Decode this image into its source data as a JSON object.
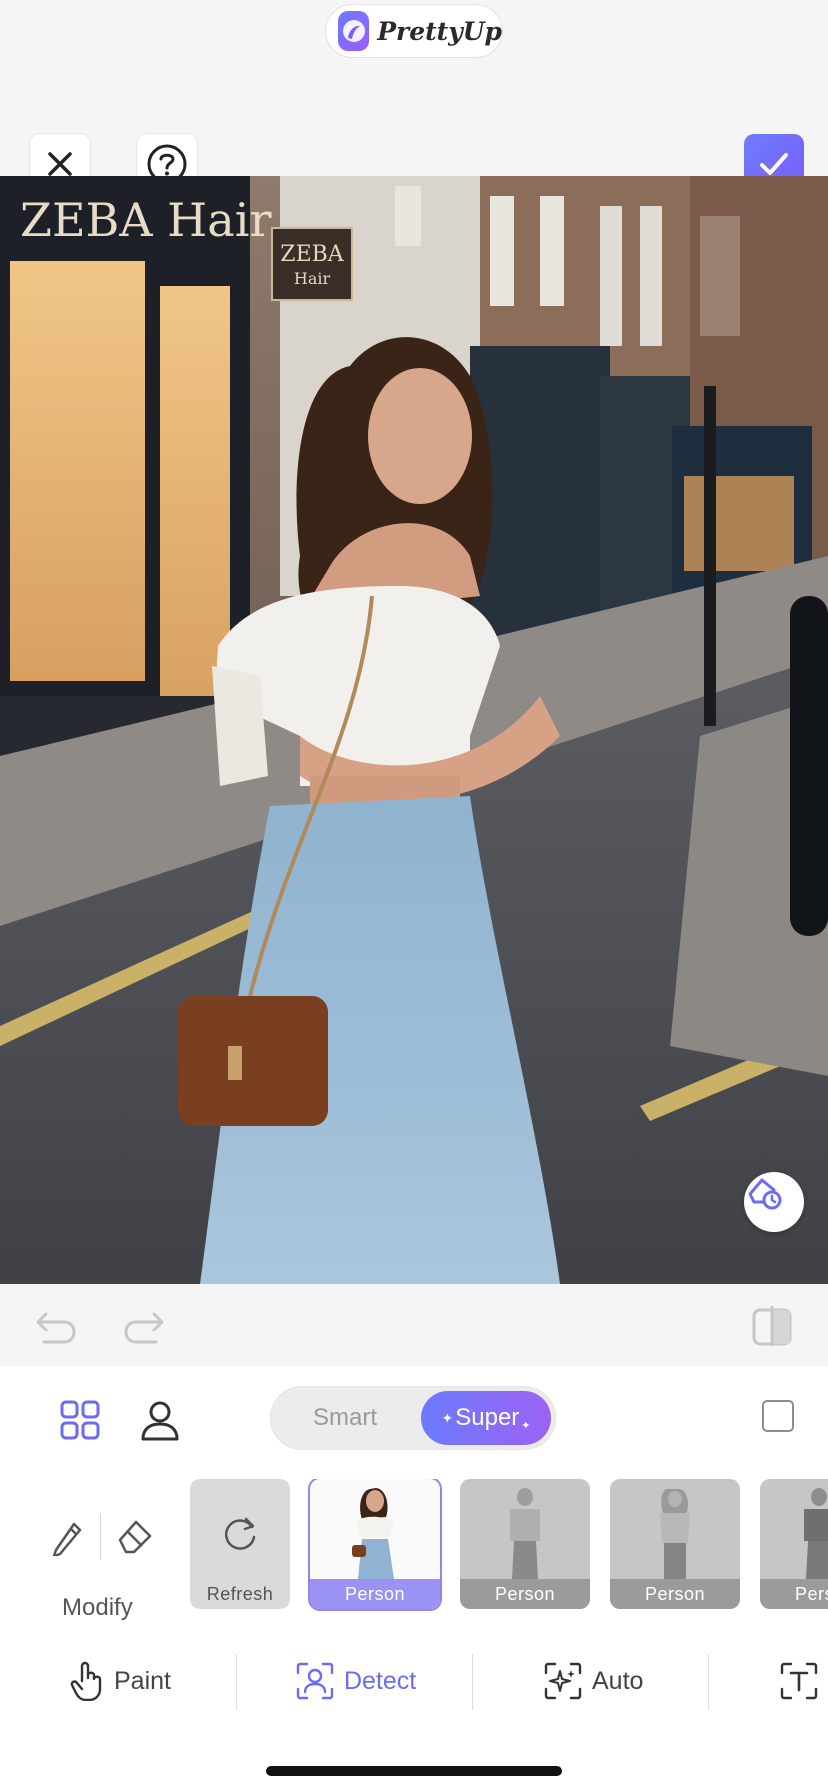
{
  "app": {
    "name": "PrettyUp"
  },
  "header": {
    "close_icon": "close-icon",
    "help_icon": "question-mark-icon",
    "confirm_icon": "checkmark-icon",
    "accent": "#6d7dff"
  },
  "photo": {
    "storefront_sign": "ZEBA Hair",
    "hanging_sign_line1": "ZEBA",
    "hanging_sign_line2": "Hair",
    "restore_icon": "eraser-clock-icon"
  },
  "history": {
    "undo_icon": "undo-icon",
    "redo_icon": "redo-icon",
    "compare_icon": "compare-icon"
  },
  "panel": {
    "grid_icon": "grid-icon",
    "person_icon": "person-icon",
    "segment": {
      "smart": "Smart",
      "super": "Super",
      "selected": "Super"
    },
    "modify_label": "Modify",
    "thumbnails": [
      {
        "label": "Refresh",
        "kind": "refresh"
      },
      {
        "label": "Person",
        "kind": "selected"
      },
      {
        "label": "Person",
        "kind": "dim"
      },
      {
        "label": "Person",
        "kind": "dim"
      },
      {
        "label": "Person",
        "kind": "dim"
      }
    ],
    "tabs": [
      {
        "label": "Paint",
        "icon": "hand-pointer-icon",
        "active": false
      },
      {
        "label": "Detect",
        "icon": "person-detect-icon",
        "active": true
      },
      {
        "label": "Auto",
        "icon": "sparkle-auto-icon",
        "active": false
      }
    ],
    "active_color": "#6b6cf0"
  }
}
